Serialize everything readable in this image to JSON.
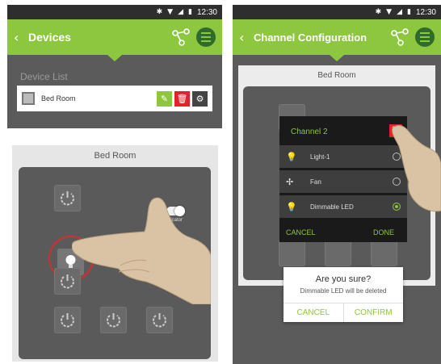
{
  "status": {
    "time": "12:30"
  },
  "devices_screen": {
    "title": "Devices",
    "section_label": "Device List",
    "devices": [
      {
        "name": "Bed Room"
      }
    ]
  },
  "room_screen": {
    "title": "Bed Room",
    "indicator_label": "Indicator",
    "switches": [
      "power-icon",
      "bulb-icon",
      "power-icon",
      "power-icon",
      "power-icon",
      "power-icon"
    ]
  },
  "channel_screen": {
    "title": "Channel Configuration",
    "card_title": "Bed Room",
    "dialog": {
      "title": "Channel 2",
      "options": [
        {
          "label": "Light-1",
          "icon": "bulb-icon",
          "selected": false
        },
        {
          "label": "Fan",
          "icon": "fan-icon",
          "selected": false
        },
        {
          "label": "Dimmable LED",
          "icon": "bulb-icon",
          "selected": true
        }
      ],
      "cancel": "CANCEL",
      "done": "DONE"
    },
    "confirm": {
      "question": "Are you sure?",
      "message": "Dimmable LED will be deleted",
      "cancel": "CANCEL",
      "confirm": "CONFIRM"
    }
  },
  "colors": {
    "accent": "#8dc63f",
    "danger": "#e2232a",
    "board": "#5a5a5a"
  }
}
